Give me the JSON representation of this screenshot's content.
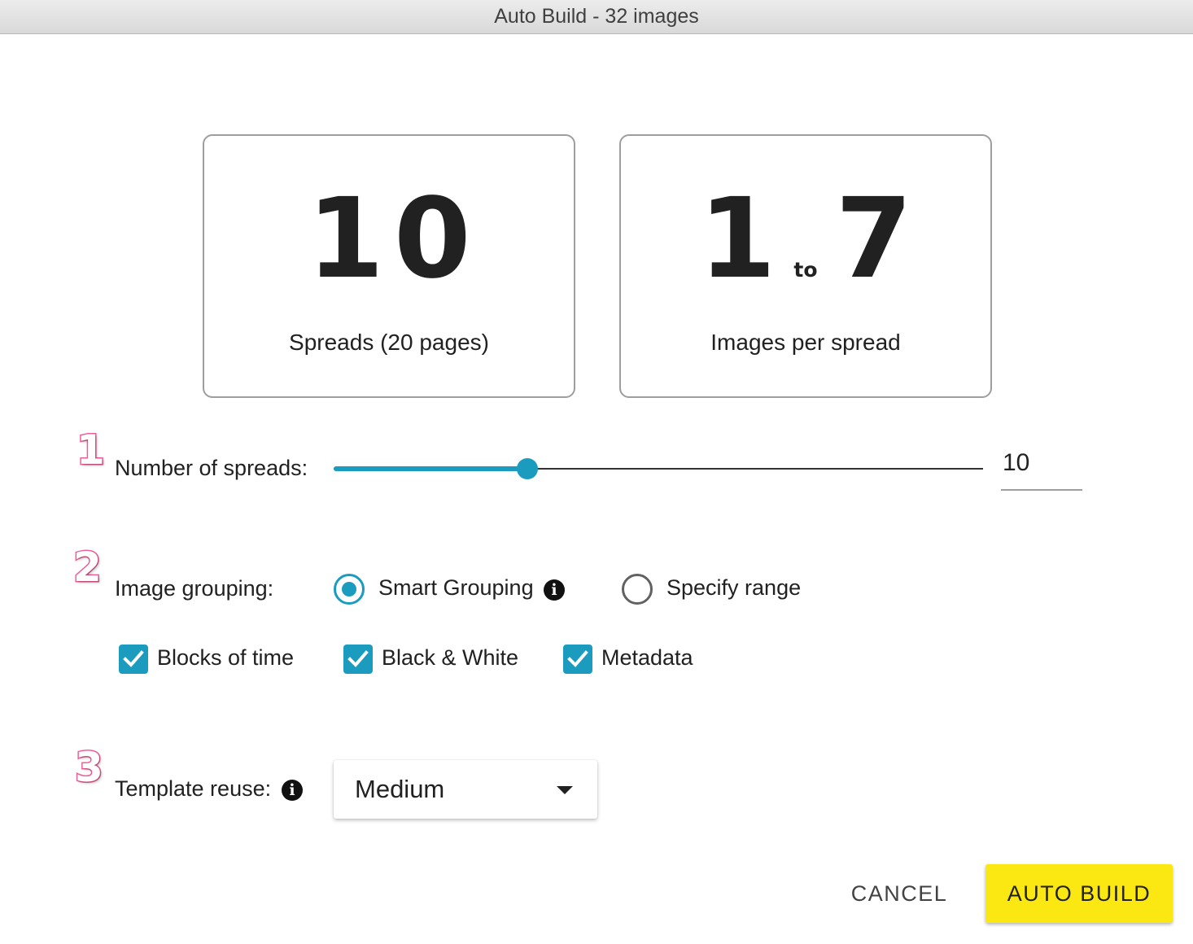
{
  "window": {
    "title": "Auto Build - 32 images"
  },
  "summary": {
    "spreads_value": "10",
    "spreads_caption": "Spreads (20 pages)",
    "images_min": "1",
    "images_to": "to",
    "images_max": "7",
    "images_caption": "Images per spread"
  },
  "steps": [
    "1",
    "2",
    "3"
  ],
  "spreads": {
    "label": "Number of spreads:",
    "value": "10",
    "slider_fraction": 0.298
  },
  "grouping": {
    "label": "Image grouping:",
    "options": [
      {
        "label": "Smart Grouping",
        "selected": true
      },
      {
        "label": "Specify range",
        "selected": false
      }
    ],
    "checkboxes": [
      {
        "label": "Blocks of time",
        "checked": true
      },
      {
        "label": "Black & White",
        "checked": true
      },
      {
        "label": "Metadata",
        "checked": true
      }
    ]
  },
  "template": {
    "label": "Template reuse:",
    "selected": "Medium"
  },
  "info_glyph": "i",
  "actions": {
    "cancel": "CANCEL",
    "auto_build": "AUTO BUILD"
  },
  "colors": {
    "accent": "#1b9cbf",
    "primary_button": "#fbe712",
    "step_number": "#f0609a"
  },
  "icons": [
    "info-icon",
    "check-icon",
    "caret-down-icon"
  ]
}
